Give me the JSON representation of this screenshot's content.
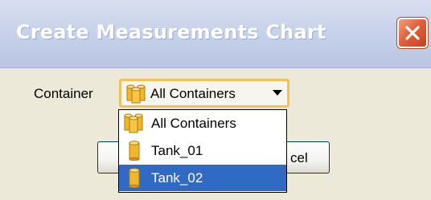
{
  "window": {
    "title": "Create Measurements Chart",
    "close_icon": "close-icon"
  },
  "form": {
    "container_label": "Container",
    "container_select": {
      "selected": "All Containers",
      "icon": "multi-cylinder-icon"
    }
  },
  "dropdown": {
    "options": [
      {
        "label": "All Containers",
        "icon": "multi-cylinder-icon",
        "selected": false
      },
      {
        "label": "Tank_01",
        "icon": "cylinder-icon",
        "selected": false
      },
      {
        "label": "Tank_02",
        "icon": "cylinder-icon",
        "selected": true
      }
    ]
  },
  "buttons": {
    "ok_label": "",
    "cancel_label_visible": "cel"
  },
  "colors": {
    "dialog_bg": "#ece9d8",
    "selection": "#316ac5",
    "focus_border": "#f2c25a",
    "close_button": "#e2613a"
  }
}
